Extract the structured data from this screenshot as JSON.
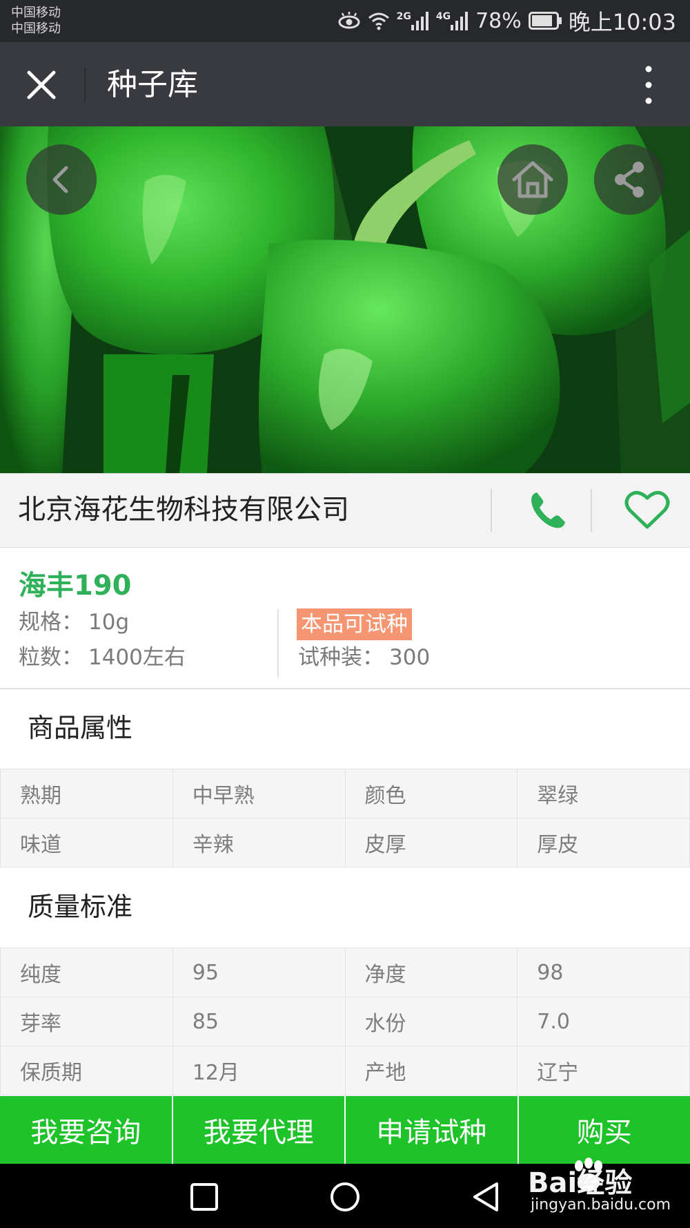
{
  "status_bar": {
    "carrier1": "中国移动",
    "carrier2": "中国移动",
    "signal_2g": "2G",
    "signal_4g": "4G",
    "battery": "78%",
    "time": "晚上10:03"
  },
  "title_bar": {
    "title": "种子库"
  },
  "hero": {
    "image_icon": "green-bell-pepper-photo",
    "back_icon": "chevron-left-icon",
    "home_icon": "home-icon",
    "share_icon": "share-icon"
  },
  "company": {
    "name": "北京海花生物科技有限公司",
    "phone_icon": "phone-icon",
    "favorite_icon": "heart-icon"
  },
  "product": {
    "name": "海丰190",
    "spec_label": "规格：",
    "spec_value": "10g",
    "count_label": "粒数：",
    "count_value": "1400左右",
    "trial_badge": "本品可试种",
    "trial_pack_label": "试种装：",
    "trial_pack_value": "300"
  },
  "attributes": {
    "title": "商品属性",
    "rows": [
      [
        "熟期",
        "中早熟",
        "颜色",
        "翠绿"
      ],
      [
        "味道",
        "辛辣",
        "皮厚",
        "厚皮"
      ]
    ]
  },
  "quality": {
    "title": "质量标准",
    "rows": [
      [
        "纯度",
        "95",
        "净度",
        "98"
      ],
      [
        "芽率",
        "85",
        "水份",
        "7.0"
      ],
      [
        "保质期",
        "12月",
        "产地",
        "辽宁"
      ]
    ]
  },
  "actions": {
    "consult": "我要咨询",
    "agent": "我要代理",
    "trial": "申请试种",
    "buy": "购买"
  },
  "watermark": {
    "logo": "Bai经验",
    "url": "jingyan.baidu.com"
  },
  "colors": {
    "accent_green": "#2fb15a",
    "action_bar": "#1ec229",
    "badge": "#f59571",
    "title_bar": "#393a3f",
    "status_bar": "#27282b"
  }
}
